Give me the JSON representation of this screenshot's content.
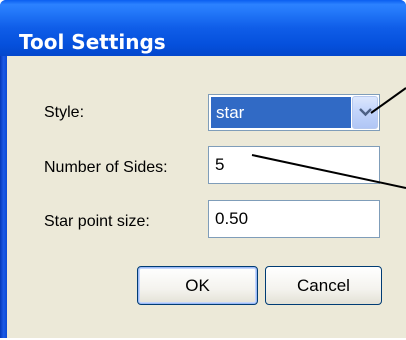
{
  "dialog": {
    "title": "Tool Settings"
  },
  "form": {
    "style": {
      "label": "Style:",
      "selected_value": "star",
      "dropdown_icon": "chevron-down-icon"
    },
    "sides": {
      "label": "Number of Sides:",
      "value": "5"
    },
    "star_point": {
      "label": "Star point size:",
      "value": "0.50"
    }
  },
  "buttons": {
    "ok_label": "OK",
    "cancel_label": "Cancel"
  },
  "colors": {
    "titlebar": "#0a5ef0",
    "dialog_face": "#ece9d8",
    "selection": "#316ac5"
  }
}
